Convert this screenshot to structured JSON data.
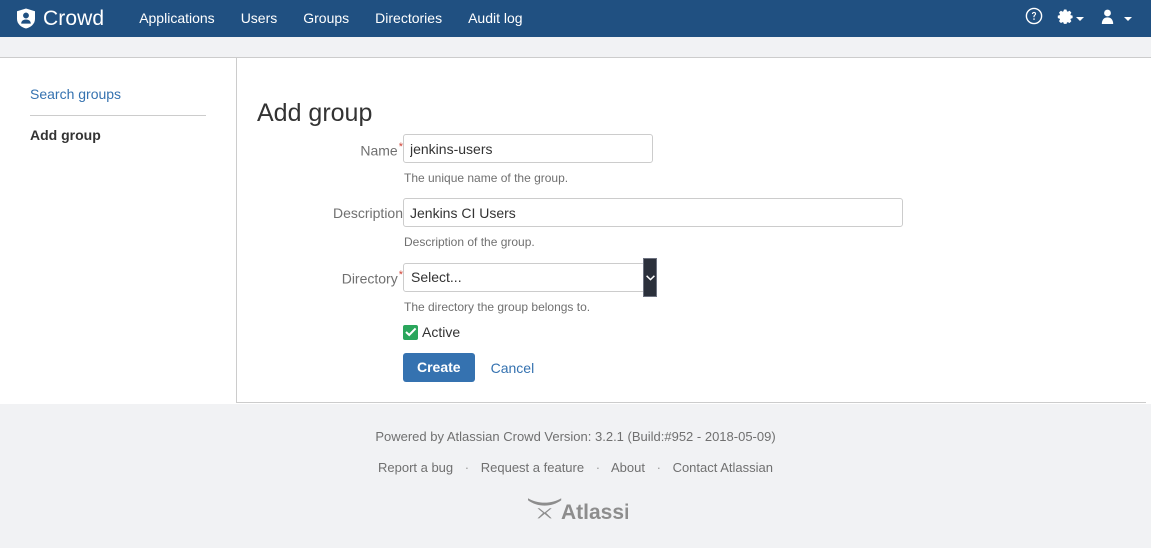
{
  "navbar": {
    "brand": "Crowd",
    "brand_icon": "crowd-shield-logo",
    "links": [
      "Applications",
      "Users",
      "Groups",
      "Directories",
      "Audit log"
    ],
    "help_icon": "help-circle-icon",
    "settings_icon": "gear-icon",
    "profile_icon": "user-avatar-icon",
    "background": "#205081"
  },
  "sidebar": {
    "search_link": "Search groups",
    "current_item": "Add group"
  },
  "main": {
    "title": "Add group",
    "fields": [
      {
        "label": "Name",
        "required": true,
        "value": "jenkins-users",
        "placeholder": "",
        "help": "The unique name of the group."
      },
      {
        "label": "Description",
        "required": false,
        "value": "Jenkins CI Users",
        "placeholder": "",
        "help": "Description of the group."
      },
      {
        "label": "Directory",
        "required": true,
        "value": "Select...",
        "help": "The directory the group belongs to."
      }
    ],
    "active_checkbox": {
      "label": "Active",
      "checked": true,
      "color": "#2aa65c"
    },
    "buttons": {
      "submit": "Create",
      "cancel": "Cancel",
      "submit_color": "#3572b0"
    }
  },
  "footer": {
    "version": "Powered by Atlassian Crowd Version: 3.2.1 (Build:#952 - 2018-05-09)",
    "links": [
      "Report a bug",
      "Request a feature",
      "About",
      "Contact Atlassian"
    ],
    "separator": "·",
    "logo": "atlassian-logo"
  }
}
